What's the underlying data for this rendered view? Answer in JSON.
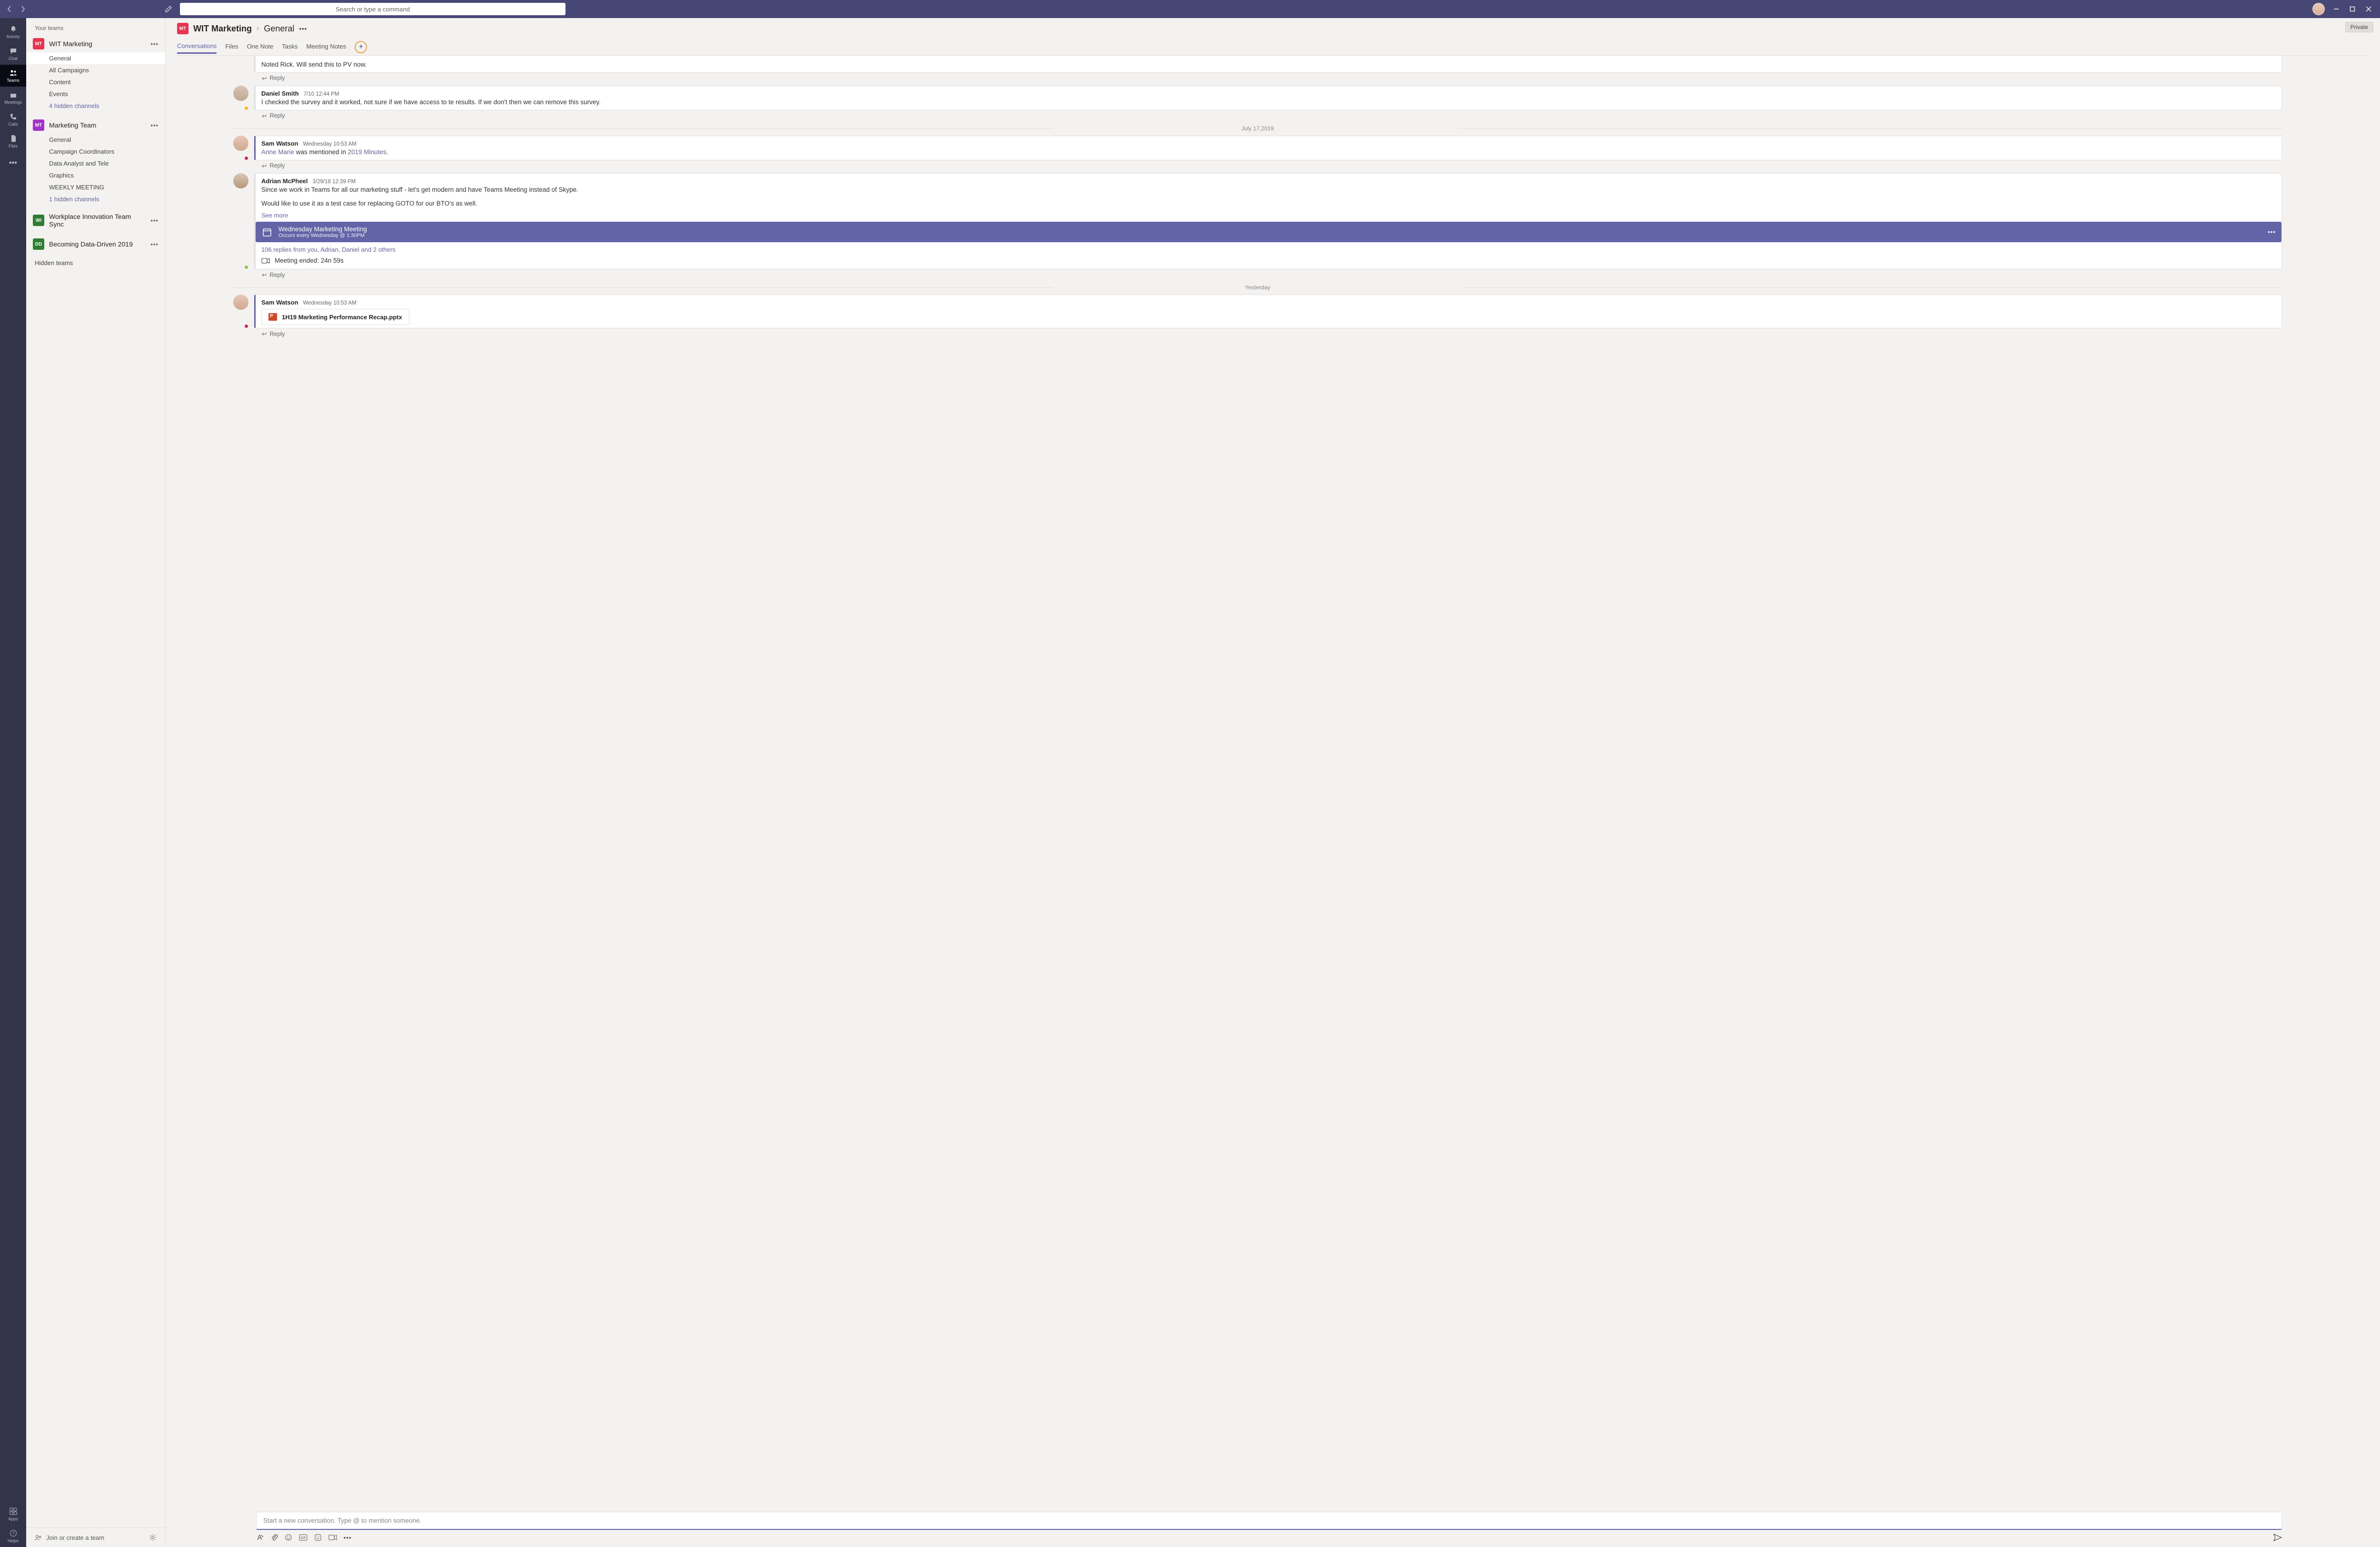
{
  "titlebar": {
    "search_placeholder": "Search or type a command"
  },
  "rail": {
    "items": [
      {
        "label": "Activity"
      },
      {
        "label": "Chat"
      },
      {
        "label": "Teams"
      },
      {
        "label": "Meetings"
      },
      {
        "label": "Calls"
      },
      {
        "label": "Files"
      }
    ],
    "apps_label": "Apps",
    "help_label": "Helps"
  },
  "sidebar": {
    "header": "Your teams",
    "teams": [
      {
        "badge": "MT",
        "color": "#e73550",
        "name": "WIT Marketing",
        "channels": [
          {
            "label": "General",
            "selected": true
          },
          {
            "label": "All Campaigns"
          },
          {
            "label": "Content"
          },
          {
            "label": "Events"
          },
          {
            "label": "4 hidden channels",
            "link": true
          }
        ]
      },
      {
        "badge": "MT",
        "color": "#a333c8",
        "name": "Marketing Team",
        "channels": [
          {
            "label": "General"
          },
          {
            "label": "Campaign Coordinators"
          },
          {
            "label": "Data Analyst and Tele"
          },
          {
            "label": "Graphics"
          },
          {
            "label": "WEEKLY MEETING"
          },
          {
            "label": "1 hidden channels",
            "link": true
          }
        ]
      },
      {
        "badge": "WI",
        "color": "#2e7d32",
        "name": "Workplace Innovation Team Sync"
      },
      {
        "badge": "DD",
        "color": "#2e7d32",
        "name": "Becoming Data-Driven 2019"
      }
    ],
    "hidden_teams": "Hidden teams",
    "join_label": "Join or create a team"
  },
  "header": {
    "team": "WIT Marketing",
    "channel": "General",
    "private": "Private",
    "tabs": [
      "Conversations",
      "Files",
      "One Note",
      "Tasks",
      "Meeting Notes"
    ]
  },
  "conversation": {
    "reply_label": "Reply",
    "msg0": {
      "text": "Noted Rick. Will send this to PV now."
    },
    "msg1": {
      "author": "Daniel Smith",
      "ts": "7/10 12:44 PM",
      "text": "I checked the survey and it worked, not sure if we have access to te results. If we don't then we can remove this survey."
    },
    "date1": "July 17,2019",
    "msg2": {
      "author": "Sam Watson",
      "ts": "Wednesday 10:53 AM",
      "mention": "Anne Marie",
      "mid": " was mentioned in ",
      "doc": "2019 Minutes",
      "tail": "."
    },
    "msg3": {
      "author": "Adrian McPheel",
      "ts": "3/29/18 12:39 PM",
      "p1": "Since we work in Teams for all our marketing stuff - let's get modern and have Teams Meeting instead of Skype.",
      "p2": "Would like to use it as a test case for replacing GOTO for our BTO's as well.",
      "see_more": "See more",
      "meeting_title": "Wednesday Marketing Meeting",
      "meeting_sub": "Occurs every Wednesday @ 1:30PM",
      "replies": "106 replies from you, Adrian, Daniel and 2 others",
      "ended": "Meeting ended: 24n 59s"
    },
    "date2": "Yesterday",
    "msg4": {
      "author": "Sam Watson",
      "ts": "Wednesday 10:53 AM",
      "file": "1H19 Marketing Performance Recap.pptx"
    }
  },
  "compose": {
    "placeholder": "Start a new conversation. Type @ to mention someone."
  }
}
